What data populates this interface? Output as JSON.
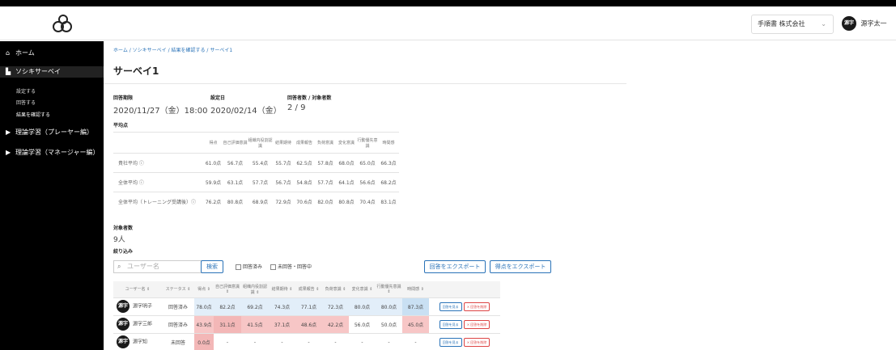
{
  "header": {
    "company": "手順書 株式会社",
    "user_avatar": "源字",
    "user_name": "源字太一"
  },
  "sidebar": {
    "home": "ホーム",
    "survey": "ソシキサーベイ",
    "sub_items": [
      "設定する",
      "回答する",
      "結果を確認する"
    ],
    "module_player": "理論学習（プレーヤー編）",
    "module_manager": "理論学習（マネージャー編）"
  },
  "breadcrumb": "ホーム / ソシキサーベイ / 結果を確認する / サーベイ1",
  "page_title": "サーベイ1",
  "summary": {
    "period_label": "回答期限",
    "period_value": "2020/11/27（金）18:00",
    "setdate_label": "設定日",
    "setdate_value": "2020/02/14（金）",
    "count_label": "回答者数 / 対象者数",
    "count_value": "2 / 9",
    "avg_label": "平均点"
  },
  "avg_table": {
    "headers": [
      "得点",
      "自己評価意識",
      "組織内役割認識",
      "結果期待",
      "成果報告",
      "負荷意識",
      "変化意識",
      "行動優先意識",
      "時間感"
    ],
    "rows": [
      {
        "label": "貴社平均 ⓘ",
        "values": [
          "61.0点",
          "56.7点",
          "55.4点",
          "55.7点",
          "62.5点",
          "57.8点",
          "68.0点",
          "65.0点",
          "66.3点"
        ]
      },
      {
        "label": "全体平均 ⓘ",
        "values": [
          "59.9点",
          "63.1点",
          "57.7点",
          "56.7点",
          "54.8点",
          "57.7点",
          "64.1点",
          "56.6点",
          "68.2点"
        ]
      },
      {
        "label": "全体平均（トレーニング受講後）ⓘ",
        "values": [
          "76.2点",
          "80.8点",
          "68.9点",
          "72.9点",
          "70.6点",
          "82.0点",
          "80.8点",
          "70.4点",
          "83.1点"
        ]
      }
    ]
  },
  "target": {
    "label": "対象者数",
    "value": "9人"
  },
  "filter": {
    "label": "絞り込み",
    "search_placeholder": "ユーザー名",
    "search_button": "検索",
    "cb_answered": "回答済み",
    "cb_unanswered": "未回答・回答中",
    "export_answers": "回答をエクスポート",
    "export_scores": "得点をエクスポート"
  },
  "results": {
    "headers": [
      "ユーザー名 ⇕",
      "ステータス ⇕",
      "得点 ⇕",
      "自己評価意識 ⇕",
      "組織内役割認識 ⇕",
      "結果期待 ⇕",
      "成果報告 ⇕",
      "負荷意識 ⇕",
      "変化意識 ⇕",
      "行動優先意識 ⇕",
      "時間感 ⇕",
      ""
    ],
    "rows": [
      {
        "avatar": "源字",
        "name": "源字明子",
        "status": "回答済み",
        "values": [
          "78.0点",
          "82.2点",
          "69.2点",
          "74.3点",
          "77.1点",
          "72.3点",
          "80.0点",
          "80.0点",
          "87.3点"
        ],
        "action1": "回答を見る",
        "action2": "× 回答を削除"
      },
      {
        "avatar": "源字",
        "name": "源字三郎",
        "status": "回答済み",
        "values": [
          "43.9点",
          "31.1点",
          "41.5点",
          "37.1点",
          "48.6点",
          "42.2点",
          "56.0点",
          "50.0点",
          "45.0点"
        ],
        "action1": "回答を見る",
        "action2": "× 回答を削除"
      },
      {
        "avatar": "源字",
        "name": "源字知",
        "status": "未回答",
        "values": [
          "0.0点",
          "-",
          "-",
          "-",
          "-",
          "-",
          "-",
          "-",
          "-"
        ],
        "action1": "回答を見る",
        "action2": "× 回答を削除"
      }
    ]
  }
}
